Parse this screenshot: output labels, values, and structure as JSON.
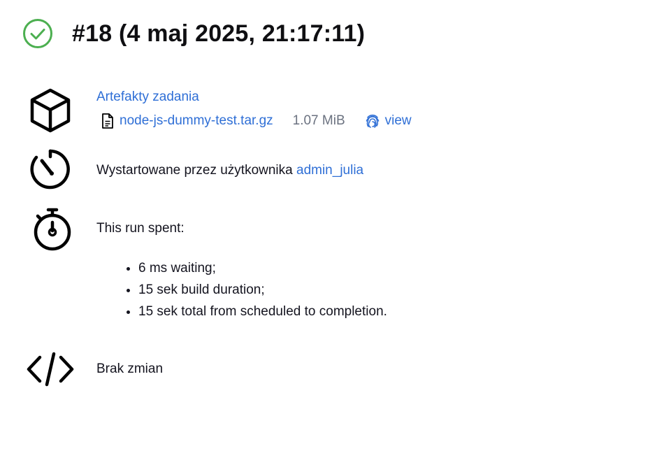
{
  "build": {
    "title": "#18 (4 maj 2025, 21:17:11)",
    "status_icon": "success-check-circle-icon",
    "status_color": "#4caf50"
  },
  "artifacts": {
    "title": "Artefakty zadania",
    "file_name": "node-js-dummy-test.tar.gz",
    "file_size": "1.07 MiB",
    "view_label": "view"
  },
  "started": {
    "text": "Wystartowane przez użytkownika ",
    "user": "admin_julia"
  },
  "spent": {
    "title": "This run spent:",
    "items": [
      "6 ms waiting;",
      "15 sek build duration;",
      "15 sek total from scheduled to completion."
    ]
  },
  "changes": {
    "text": "Brak zmian"
  },
  "colors": {
    "link": "#2f6fd6",
    "muted": "#6b7280",
    "success": "#4caf50"
  }
}
